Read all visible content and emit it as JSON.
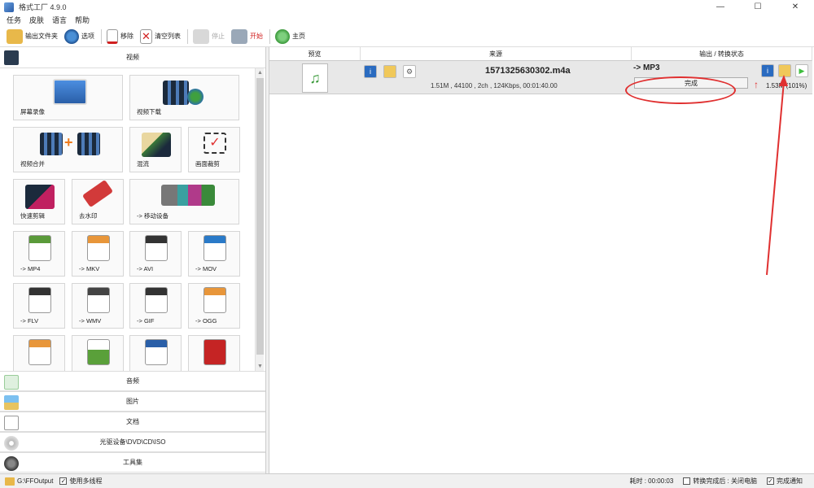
{
  "window": {
    "title": "格式工厂 4.9.0",
    "minimize": "—",
    "maximize": "☐",
    "close": "✕"
  },
  "menu": [
    "任务",
    "皮肤",
    "语言",
    "帮助"
  ],
  "toolbar": {
    "output_folder": "输出文件夹",
    "options": "选项",
    "remove": "移除",
    "clear_list": "清空列表",
    "stop": "停止",
    "start": "开始",
    "home": "主页"
  },
  "sidebar": {
    "video_header": "视频",
    "tiles": [
      {
        "label": "屏幕录像",
        "icon": "screen-record-icon"
      },
      {
        "label": "视频下载",
        "icon": "video-download-icon"
      },
      {
        "label": "视频合并",
        "icon": "video-merge-icon"
      },
      {
        "label": "混流",
        "icon": "mux-icon"
      },
      {
        "label": "画面裁剪",
        "icon": "crop-icon"
      },
      {
        "label": "快速剪辑",
        "icon": "quick-edit-icon"
      },
      {
        "label": "去水印",
        "icon": "remove-watermark-icon"
      },
      {
        "label": "-> 移动设备",
        "icon": "mobile-device-icon"
      },
      {
        "label": "-> MP4",
        "icon": "mp4-icon"
      },
      {
        "label": "-> MKV",
        "icon": "mkv-icon"
      },
      {
        "label": "-> AVI",
        "icon": "avi-icon"
      },
      {
        "label": "-> MOV",
        "icon": "mov-icon"
      },
      {
        "label": "-> FLV",
        "icon": "flv-icon"
      },
      {
        "label": "-> WMV",
        "icon": "wmv-icon"
      },
      {
        "label": "-> GIF",
        "icon": "gif-icon"
      },
      {
        "label": "-> OGG",
        "icon": "ogg-icon"
      },
      {
        "label": "",
        "icon": "webm-icon"
      },
      {
        "label": "",
        "icon": "3gp-icon"
      },
      {
        "label": "",
        "icon": "mpeg-icon"
      },
      {
        "label": "",
        "icon": "swf-icon"
      }
    ],
    "categories": [
      "音频",
      "图片",
      "文档",
      "光驱设备\\DVD\\CD\\ISO",
      "工具集"
    ]
  },
  "task_list": {
    "headers": {
      "preview": "预览",
      "source": "来源",
      "output": "输出 / 转换状态"
    },
    "task": {
      "filename": "1571325630302.m4a",
      "info": "1.51M , 44100 , 2ch , 124Kbps, 00:01:40.00",
      "output_format": "-> MP3",
      "status": "完成",
      "progress": 1.0,
      "output_size": "1.53M (101%)"
    }
  },
  "statusbar": {
    "output_path": "G:\\FFOutput",
    "multithread": "使用多线程",
    "elapsed": "耗时 : 00:00:03",
    "after_done": "转换完成后 : 关闭电脑",
    "notify": "完成通知"
  },
  "colors": {
    "accent_red": "#e03030",
    "folder": "#e8b84a",
    "start_green": "#3fbf3f"
  }
}
